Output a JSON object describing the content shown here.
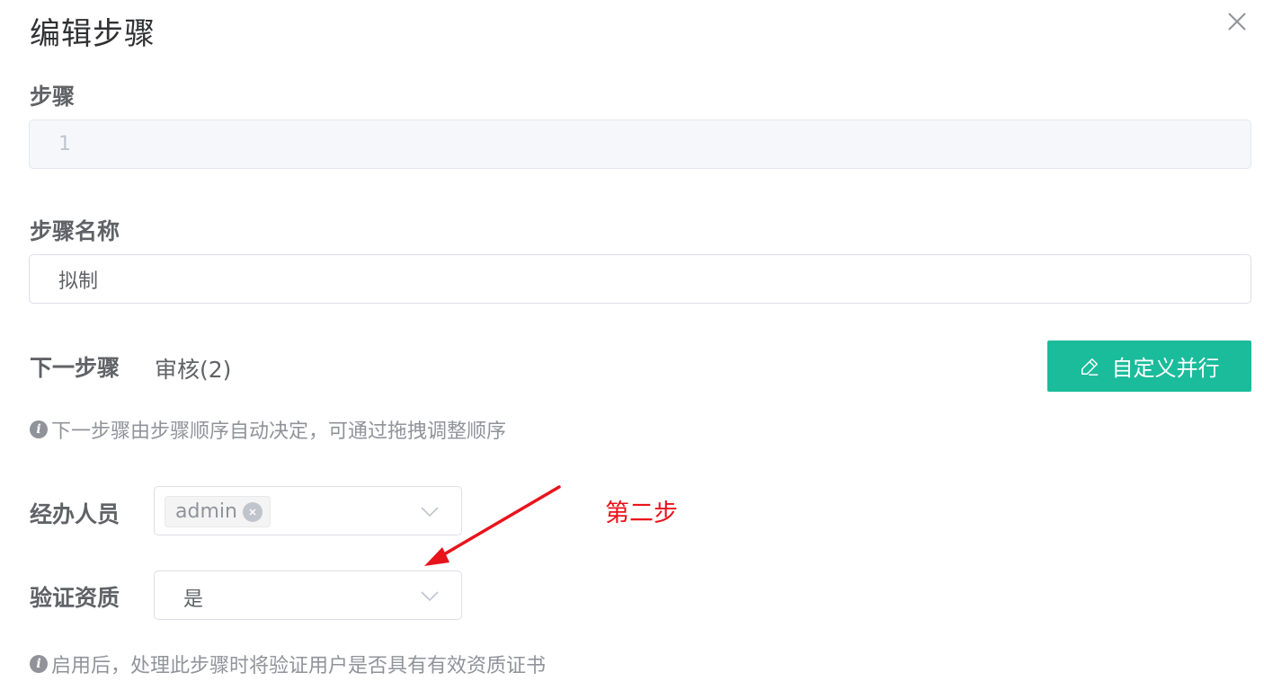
{
  "dialog": {
    "title": "编辑步骤",
    "close_icon": "close-icon"
  },
  "step": {
    "label": "步骤",
    "value": "1"
  },
  "step_name": {
    "label": "步骤名称",
    "value": "拟制"
  },
  "next_step": {
    "label": "下一步骤",
    "value": "审核(2)",
    "custom_button_label": "自定义并行",
    "custom_button_icon": "edit-pencil-icon",
    "hint": "下一步骤由步骤顺序自动决定，可通过拖拽调整顺序"
  },
  "handler": {
    "label": "经办人员",
    "tags": [
      "admin"
    ]
  },
  "verify": {
    "label": "验证资质",
    "value": "是",
    "hint": "启用后，处理此步骤时将验证用户是否具有有效资质证书"
  },
  "annotation": {
    "text": "第二步",
    "color": "#e8141c"
  },
  "colors": {
    "primary_button": "#1bbc9b"
  }
}
